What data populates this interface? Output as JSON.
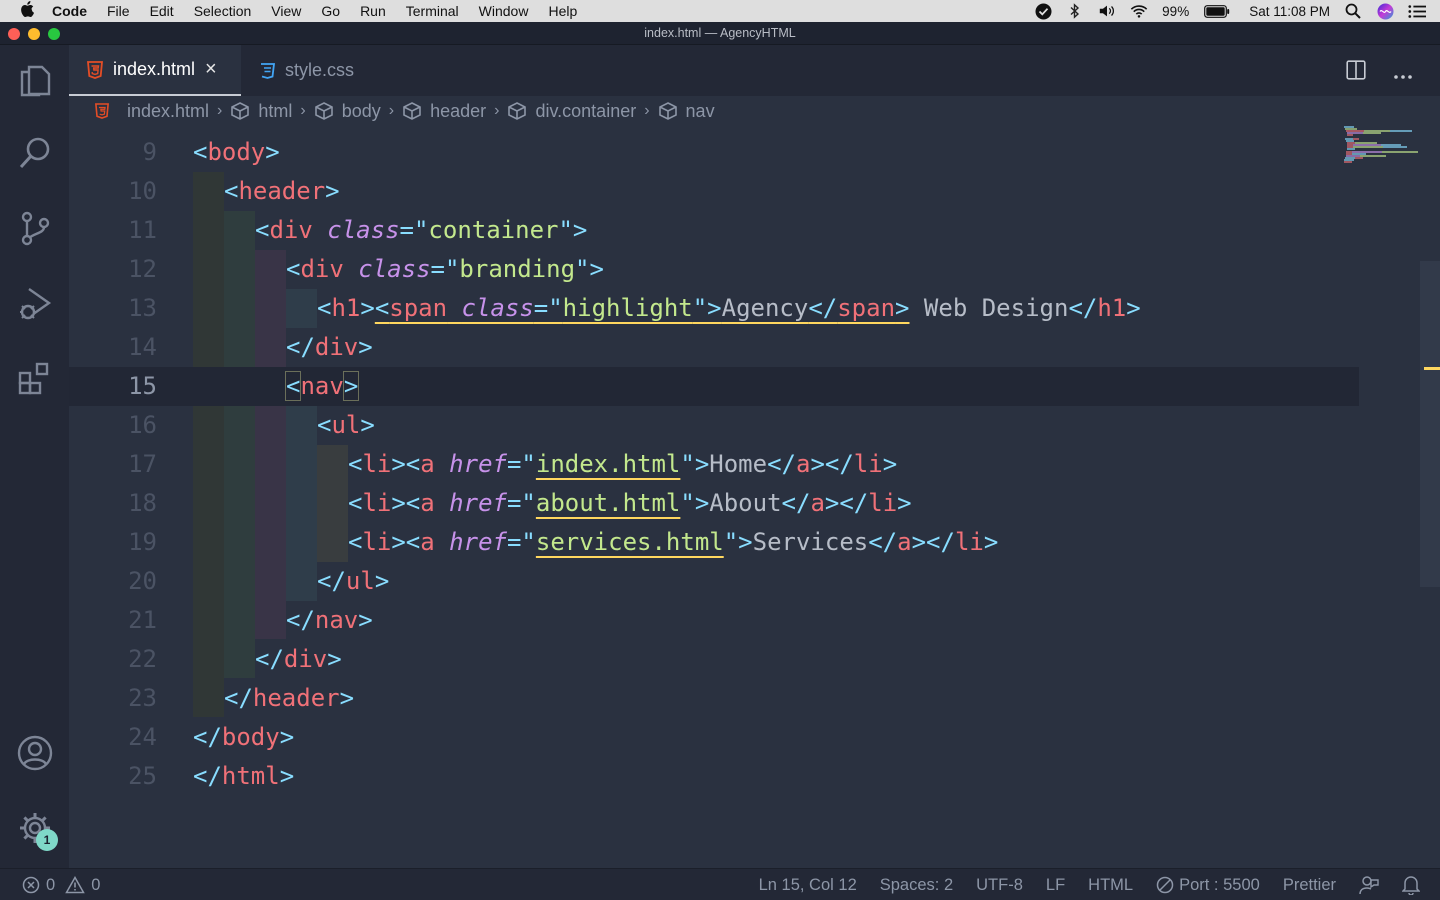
{
  "menubar": {
    "app": "Code",
    "items": [
      "File",
      "Edit",
      "Selection",
      "View",
      "Go",
      "Run",
      "Terminal",
      "Window",
      "Help"
    ],
    "battery": "99%",
    "clock": "Sat 11:08 PM"
  },
  "window": {
    "title": "index.html — AgencyHTML"
  },
  "tabs": [
    {
      "label": "index.html",
      "icon": "html5-icon",
      "active": true
    },
    {
      "label": "style.css",
      "icon": "css3-icon",
      "active": false
    }
  ],
  "breadcrumbs": [
    "index.html",
    "html",
    "body",
    "header",
    "div.container",
    "nav"
  ],
  "editor": {
    "current_line": 15,
    "lines": [
      {
        "n": "9"
      },
      {
        "n": "10"
      },
      {
        "n": "11"
      },
      {
        "n": "12"
      },
      {
        "n": "13"
      },
      {
        "n": "14"
      },
      {
        "n": "15"
      },
      {
        "n": "16"
      },
      {
        "n": "17"
      },
      {
        "n": "18"
      },
      {
        "n": "19"
      },
      {
        "n": "20"
      },
      {
        "n": "21"
      },
      {
        "n": "22"
      },
      {
        "n": "23"
      },
      {
        "n": "24"
      },
      {
        "n": "25"
      }
    ],
    "code": {
      "l9_tag": "body",
      "l10_tag": "header",
      "l11_tag": "div",
      "l11_attr": "class",
      "l11_val": "container",
      "l12_tag": "div",
      "l12_attr": "class",
      "l12_val": "branding",
      "l13_tag": "h1",
      "l13_span": "span",
      "l13_attr": "class",
      "l13_val": "highlight",
      "l13_text": "Agency",
      "l13_rest": " Web Design",
      "l15_tag": "nav",
      "l16_tag": "ul",
      "l17_href": "index.html",
      "l17_text": "Home",
      "l18_href": "about.html",
      "l18_text": "About",
      "l19_href": "services.html",
      "l19_text": "Services",
      "li": "li",
      "a": "a",
      "href": "href",
      "l20_tag": "ul",
      "l21_tag": "nav",
      "l22_tag": "div",
      "l23_tag": "header",
      "l24_tag": "body",
      "l25_tag": "html"
    }
  },
  "statusbar": {
    "errors": "0",
    "warnings": "0",
    "position": "Ln 15, Col 12",
    "spaces": "Spaces: 2",
    "encoding": "UTF-8",
    "eol": "LF",
    "language": "HTML",
    "port": "Port : 5500",
    "formatter": "Prettier"
  },
  "settings_badge": "1",
  "colors": {
    "editor_bg": "#2a3140",
    "tag": "#f07178",
    "bracket": "#89ddff",
    "attribute": "#c792ea",
    "string": "#c3e88d",
    "warning_underline": "#ffd75f"
  }
}
